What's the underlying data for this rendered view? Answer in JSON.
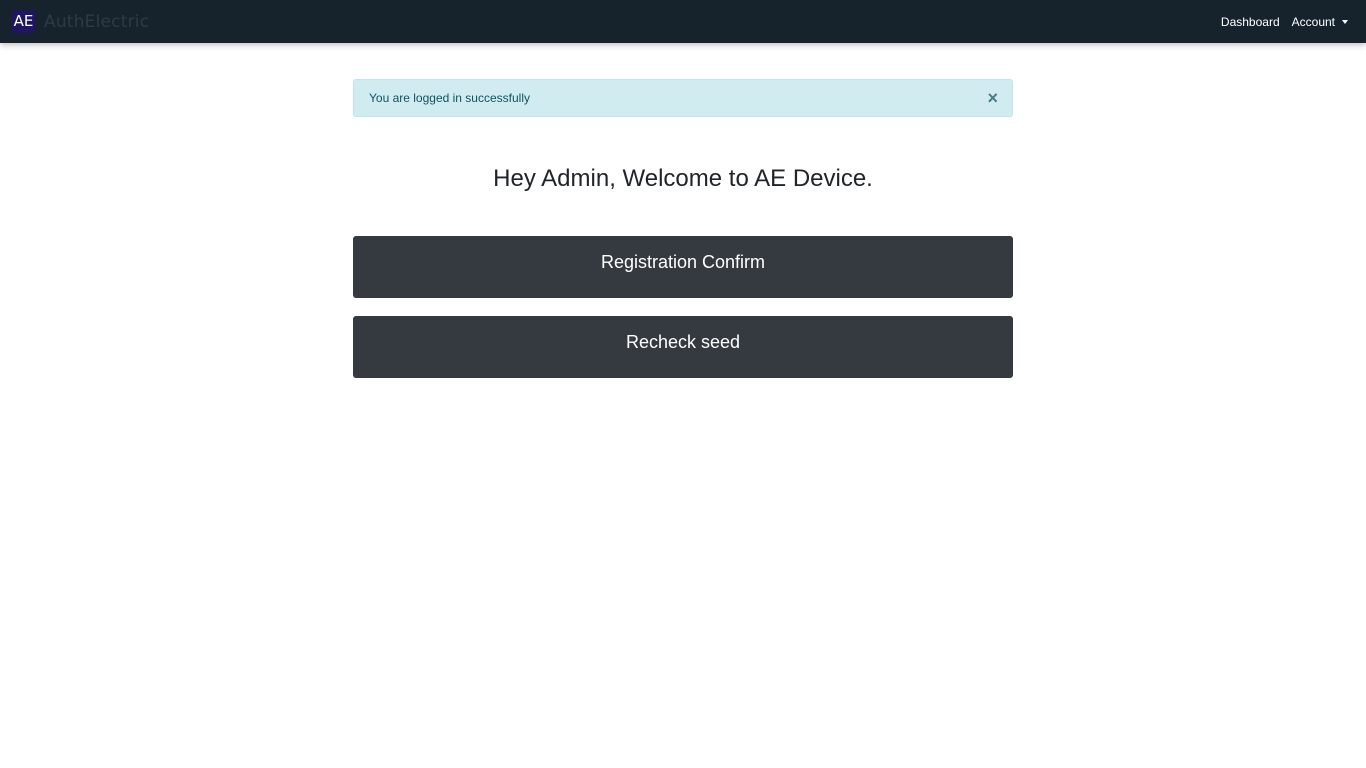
{
  "navbar": {
    "logo_text": "AE",
    "brand_name": "AuthElectric",
    "links": {
      "dashboard": "Dashboard",
      "account": "Account"
    },
    "colors": {
      "background": "#17232c",
      "logo_bg": "#1e1660"
    }
  },
  "alert": {
    "message": "You are logged in successfully",
    "close_symbol": "×",
    "type": "info"
  },
  "main": {
    "welcome_text": "Hey Admin, Welcome to AE Device.",
    "buttons": {
      "registration_confirm": "Registration Confirm",
      "recheck_seed": "Recheck seed"
    }
  }
}
